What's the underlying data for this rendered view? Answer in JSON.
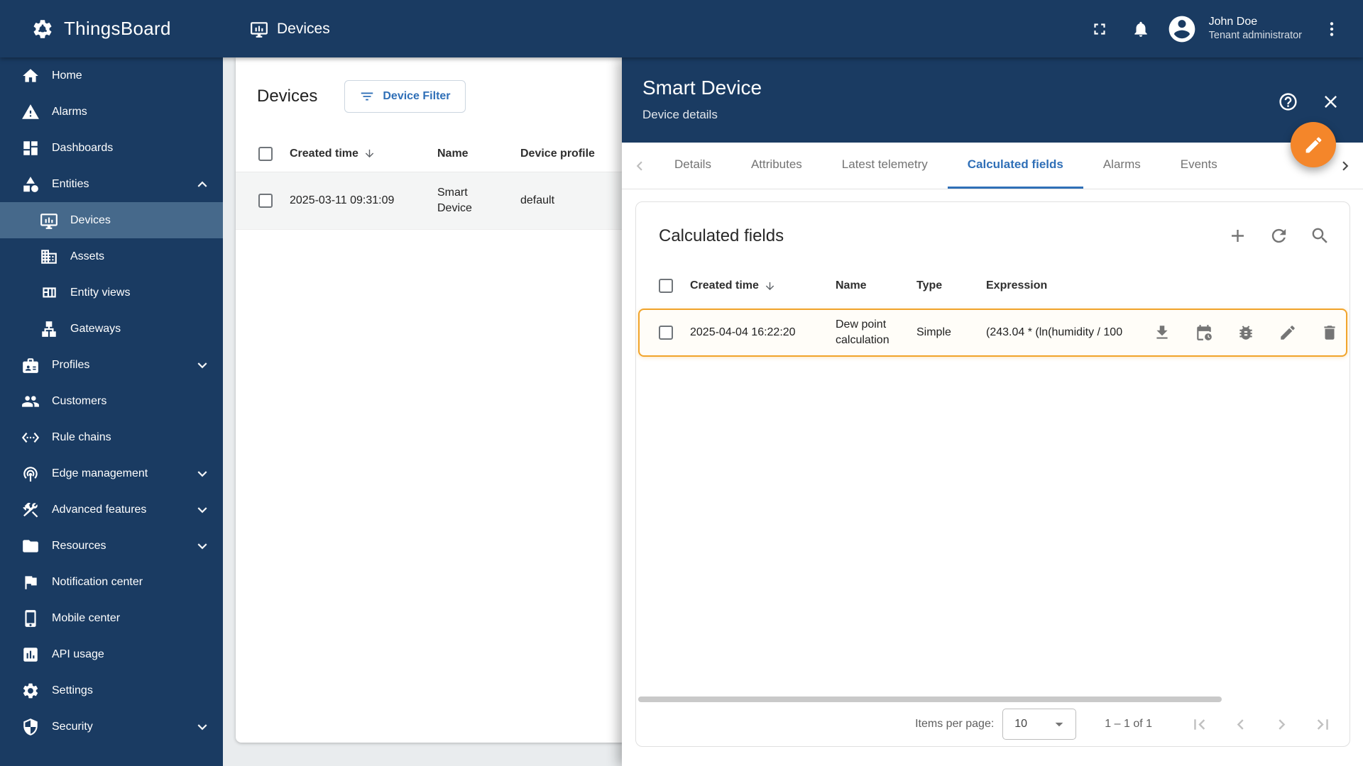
{
  "app": {
    "name": "ThingsBoard"
  },
  "topbar": {
    "breadcrumb": "Devices",
    "user": {
      "name": "John Doe",
      "role": "Tenant administrator"
    }
  },
  "sidebar": {
    "items": [
      {
        "label": "Home",
        "icon": "home"
      },
      {
        "label": "Alarms",
        "icon": "warning"
      },
      {
        "label": "Dashboards",
        "icon": "dashboard"
      },
      {
        "label": "Entities",
        "icon": "category",
        "expanded": true
      },
      {
        "label": "Devices",
        "icon": "devices",
        "sub": true,
        "selected": true
      },
      {
        "label": "Assets",
        "icon": "domain",
        "sub": true
      },
      {
        "label": "Entity views",
        "icon": "view-quilt",
        "sub": true
      },
      {
        "label": "Gateways",
        "icon": "lan",
        "sub": true
      },
      {
        "label": "Profiles",
        "icon": "badge",
        "collapsed": true
      },
      {
        "label": "Customers",
        "icon": "people"
      },
      {
        "label": "Rule chains",
        "icon": "settings-ethernet"
      },
      {
        "label": "Edge management",
        "icon": "wifi-tethering",
        "collapsed": true
      },
      {
        "label": "Advanced features",
        "icon": "construction",
        "collapsed": true
      },
      {
        "label": "Resources",
        "icon": "folder",
        "collapsed": true
      },
      {
        "label": "Notification center",
        "icon": "flag"
      },
      {
        "label": "Mobile center",
        "icon": "smartphone"
      },
      {
        "label": "API usage",
        "icon": "insert-chart"
      },
      {
        "label": "Settings",
        "icon": "settings"
      },
      {
        "label": "Security",
        "icon": "security",
        "collapsed": true
      }
    ]
  },
  "devices_table": {
    "title": "Devices",
    "filter_button": "Device Filter",
    "columns": {
      "created_time": "Created time",
      "name": "Name",
      "device_profile": "Device profile"
    },
    "row": {
      "created_time": "2025-03-11 09:31:09",
      "name": "Smart Device",
      "device_profile": "default"
    }
  },
  "details_panel": {
    "title": "Smart Device",
    "subtitle": "Device details",
    "tabs": [
      "Details",
      "Attributes",
      "Latest telemetry",
      "Calculated fields",
      "Alarms",
      "Events"
    ],
    "active_tab": "Calculated fields"
  },
  "calculated_fields": {
    "title": "Calculated fields",
    "columns": {
      "created_time": "Created time",
      "name": "Name",
      "type": "Type",
      "expression": "Expression"
    },
    "row": {
      "created_time": "2025-04-04 16:22:20",
      "name": "Dew point calculation",
      "type": "Simple",
      "expression": "(243.04 * (ln(humidity / 100"
    },
    "pagination": {
      "items_per_page_label": "Items per page:",
      "page_size": "10",
      "range": "1 – 1 of 1"
    }
  },
  "colors": {
    "primary_navy": "#1a3b62",
    "sidebar_selected": "#46698b",
    "accent_orange_fab": "#f4862a",
    "row_highlight_border": "#f1a42b",
    "active_tab_blue": "#2f6fb7"
  }
}
